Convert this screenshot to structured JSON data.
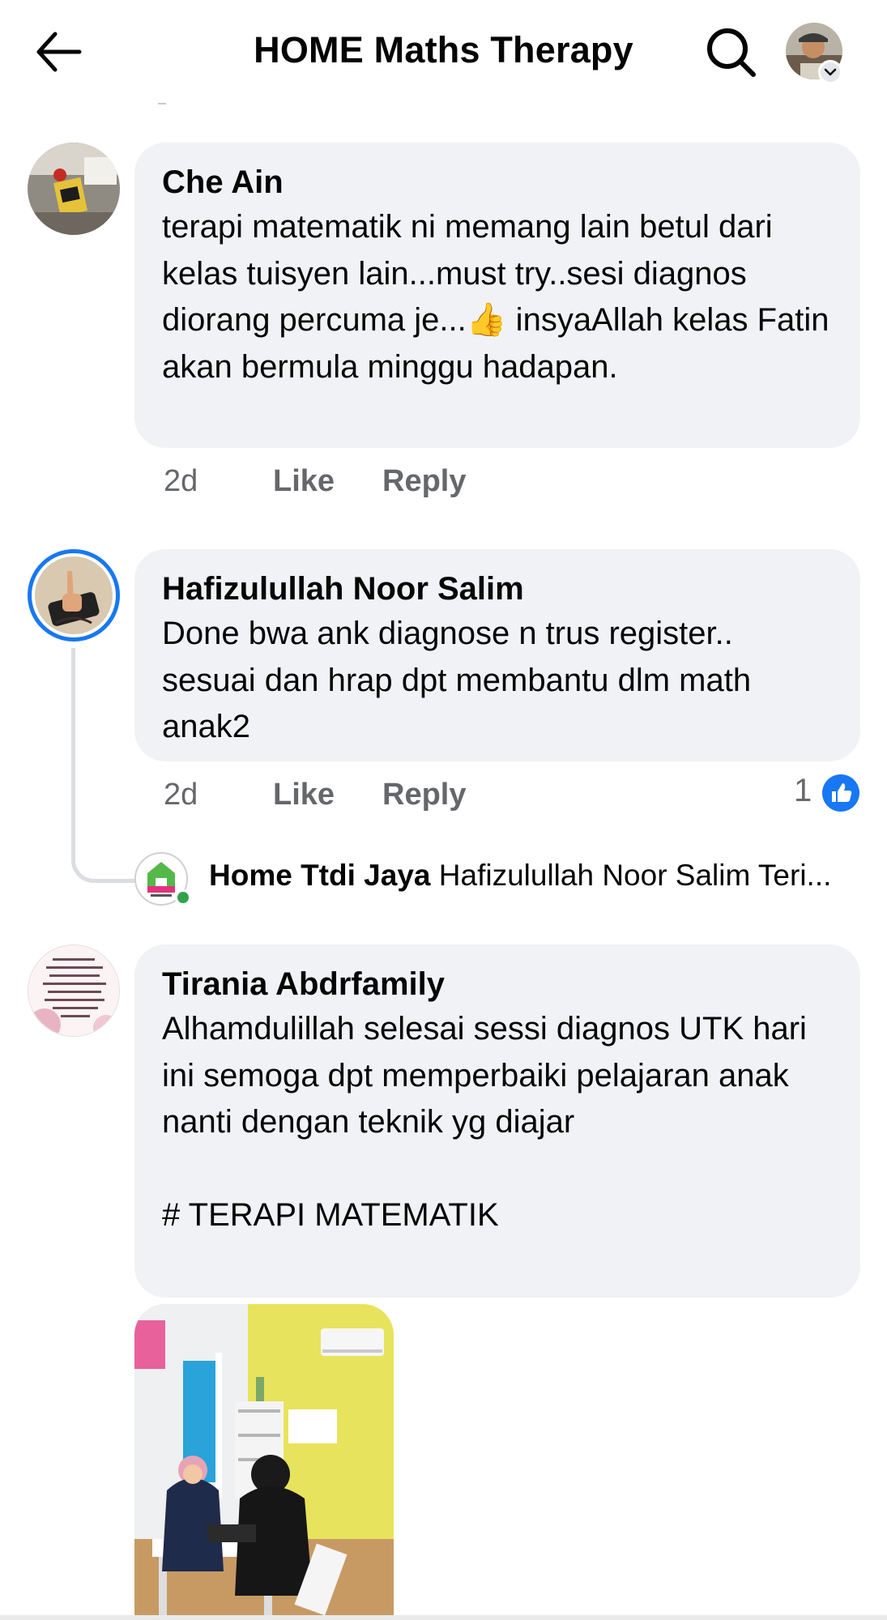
{
  "header": {
    "title": "HOME Maths Therapy",
    "back_icon": "arrow-left-icon",
    "search_icon": "search-icon"
  },
  "comments": [
    {
      "author": "Che Ain",
      "text": "terapi matematik ni memang lain betul dari kelas tuisyen lain...must try..sesi diagnos diorang percuma je...👍 insyaAllah kelas Fatin akan bermula minggu hadapan.",
      "time": "2d",
      "like_label": "Like",
      "reply_label": "Reply"
    },
    {
      "author": "Hafizulullah Noor Salim",
      "text": "Done bwa ank diagnose n trus register.. sesuai dan hrap dpt membantu dlm math anak2",
      "time": "2d",
      "like_label": "Like",
      "reply_label": "Reply",
      "reaction_count": "1",
      "reply_preview": {
        "author": "Home Ttdi Jaya",
        "text": "Hafizulullah Noor Salim Teri..."
      }
    },
    {
      "author": "Tirania Abdrfamily",
      "text": "Alhamdulillah selesai sessi diagnos UTK hari ini semoga dpt memperbaiki pelajaran anak nanti dengan teknik yg diajar\n\n# TERAPI MATEMATIK"
    }
  ],
  "colors": {
    "bubble_bg": "#f0f2f5",
    "meta_text": "#65676b",
    "like_blue": "#1877f2",
    "story_ring": "#1877f2",
    "online_green": "#31a24c"
  }
}
